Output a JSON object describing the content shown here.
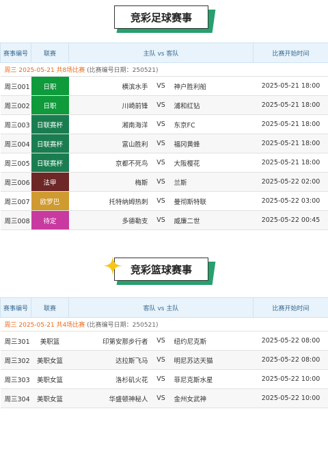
{
  "football": {
    "title": "竞彩足球赛事",
    "headers": [
      "赛事编号",
      "联赛",
      "主队 vs 客队",
      "比赛开始时间"
    ],
    "info": {
      "main": "周三 2025-05-21 共8场比赛",
      "extra": "(比赛编号日期：250521)"
    },
    "matches": [
      {
        "num": "周三001",
        "league": "日职",
        "color": "#0f9a3c",
        "home": "横滨水手",
        "vs": "VS",
        "away": "神户胜利船",
        "time": "2025-05-21 18:00"
      },
      {
        "num": "周三002",
        "league": "日职",
        "color": "#0f9a3c",
        "home": "川崎前锋",
        "vs": "VS",
        "away": "浦和红钻",
        "time": "2025-05-21 18:00"
      },
      {
        "num": "周三003",
        "league": "日联赛杯",
        "color": "#1a7d50",
        "home": "湘南海洋",
        "vs": "VS",
        "away": "东京FC",
        "time": "2025-05-21 18:00"
      },
      {
        "num": "周三004",
        "league": "日联赛杯",
        "color": "#1a7d50",
        "home": "富山胜利",
        "vs": "VS",
        "away": "福冈黄蜂",
        "time": "2025-05-21 18:00"
      },
      {
        "num": "周三005",
        "league": "日联赛杯",
        "color": "#1a7d50",
        "home": "京都不死鸟",
        "vs": "VS",
        "away": "大阪樱花",
        "time": "2025-05-21 18:00"
      },
      {
        "num": "周三006",
        "league": "法甲",
        "color": "#6e2727",
        "home": "梅斯",
        "vs": "VS",
        "away": "兰斯",
        "time": "2025-05-22 02:00"
      },
      {
        "num": "周三007",
        "league": "欧罗巴",
        "color": "#cf9a30",
        "home": "托特纳姆热刺",
        "vs": "VS",
        "away": "曼彻斯特联",
        "time": "2025-05-22 03:00"
      },
      {
        "num": "周三008",
        "league": "待定",
        "color": "#c83aa0",
        "home": "多德勒支",
        "vs": "VS",
        "away": "威廉二世",
        "time": "2025-05-22 00:45"
      }
    ]
  },
  "basketball": {
    "title": "竞彩篮球赛事",
    "headers": [
      "赛事编号",
      "联赛",
      "客队 vs 主队",
      "比赛开始时间"
    ],
    "info": {
      "main": "周三 2025-05-21 共4场比赛",
      "extra": "(比赛编号日期：250521)"
    },
    "matches": [
      {
        "num": "周三301",
        "league": "美职篮",
        "home": "印第安那步行者",
        "vs": "VS",
        "away": "纽约尼克斯",
        "time": "2025-05-22 08:00"
      },
      {
        "num": "周三302",
        "league": "美职女篮",
        "home": "达拉斯飞马",
        "vs": "VS",
        "away": "明尼苏达天猫",
        "time": "2025-05-22 08:00"
      },
      {
        "num": "周三303",
        "league": "美职女篮",
        "home": "洛杉矶火花",
        "vs": "VS",
        "away": "菲尼克斯水星",
        "time": "2025-05-22 10:00"
      },
      {
        "num": "周三304",
        "league": "美职女篮",
        "home": "华盛顿神秘人",
        "vs": "VS",
        "away": "金州女武神",
        "time": "2025-05-22 10:00"
      }
    ]
  }
}
